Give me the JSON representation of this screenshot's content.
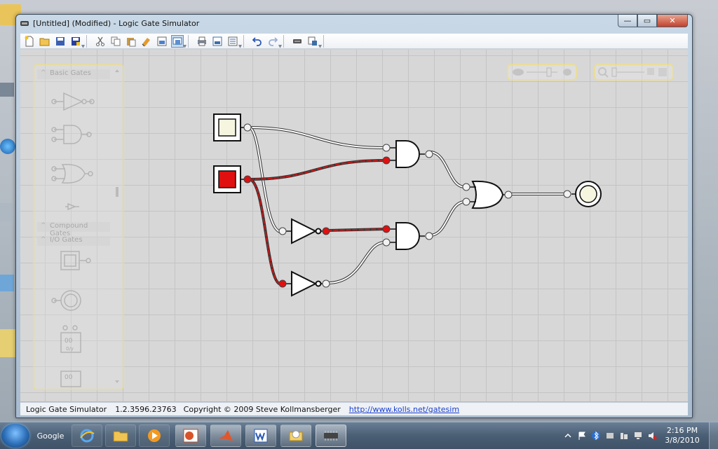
{
  "window": {
    "title": "[Untitled] (Modified)  - Logic Gate Simulator",
    "controls": {
      "minimize": "—",
      "maximize": "▭",
      "close": "✕"
    }
  },
  "toolbar": {
    "buttons": [
      "new-icon",
      "open-icon",
      "save-icon",
      "save-as-icon",
      "cut-icon",
      "copy-icon",
      "paste-icon",
      "clear-icon",
      "image-icon",
      "chip-icon",
      "print-icon",
      "print-preview-icon",
      "properties-icon",
      "undo-icon",
      "redo-icon",
      "integrated-circuit-icon",
      "export-icon"
    ]
  },
  "palette": {
    "sections": [
      "Basic Gates",
      "Compound Gates",
      "I/O Gates"
    ],
    "io_label": "00",
    "io_sublabel": "0/y"
  },
  "circuit": {
    "input1_state": "off",
    "input2_state": "on",
    "on_color": "#e01010",
    "wire_on_color": "#c81818"
  },
  "statusbar": {
    "app": "Logic Gate Simulator",
    "version": "1.2.3596.23763",
    "copyright": "Copyright © 2009 Steve Kollmansberger",
    "url": "http://www.kolls.net/gatesim"
  },
  "taskbar": {
    "search_label": "Google",
    "items": [
      "internet-explorer-icon",
      "folder-icon",
      "media-player-icon",
      "powerpoint-icon",
      "matlab-icon",
      "word-icon",
      "outlook-icon",
      "gate-simulator-icon"
    ],
    "time": "2:16 PM",
    "date": "3/8/2010"
  }
}
